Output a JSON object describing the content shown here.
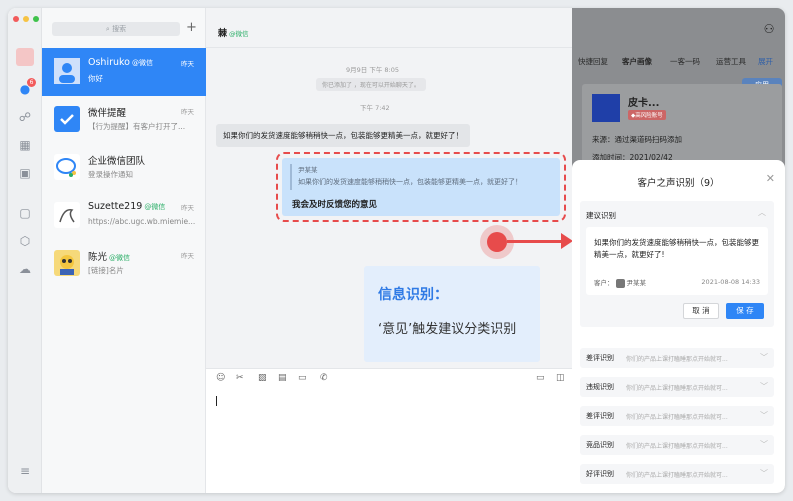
{
  "list": {
    "search_placeholder": "搜索",
    "conversations": [
      {
        "name": "Oshiruko",
        "tag": "@微信",
        "time": "昨天",
        "msg": "你好"
      },
      {
        "name": "微伴提醒",
        "tag": "",
        "time": "昨天",
        "msg": "【行为提醒】有客户打开了..."
      },
      {
        "name": "企业微信团队",
        "tag": "",
        "time": "",
        "msg": "登录操作通知"
      },
      {
        "name": "Suzette219",
        "tag": "@微信",
        "time": "昨天",
        "msg": "https://abc.ugc.wb.miemie..."
      },
      {
        "name": "陈光",
        "tag": "@微信",
        "time": "昨天",
        "msg": "[链接]名片"
      }
    ]
  },
  "chat": {
    "title": "棘",
    "title_tag": "@微信",
    "time1": "9月9日 下午 8:05",
    "sys_msg": "你已添加了      ，现在可以开始聊天了。",
    "time2": "下午 7:42",
    "left_msg": "如果你们的发货速度能够稍稍快一点，包装能够更精美一点，就更好了！",
    "quote_name": "尹某某",
    "quote_text": "如果你们的发货速度能够稍稍快一点，包装能够更精美一点，就更好了！",
    "reply_text": "我会及时反馈您的意见",
    "info_title": "信息识别：",
    "info_sub": "‘意见’触发建议分类识别"
  },
  "right": {
    "tabs": [
      "快捷回复",
      "客户画像",
      "一客一码",
      "运营工具",
      "展开"
    ],
    "apply_label": "应用",
    "customer_name": "皮卡...",
    "customer_badge": "◆高风险账号",
    "source_label": "来源：",
    "source_value": "通过渠道码扫码添加",
    "added_label": "添加时间：",
    "added_value": "2021/02/42"
  },
  "panel": {
    "title": "客户之声识别（9）",
    "open_section": {
      "label": "建议识别",
      "text": "如果你们的发货速度能够稍稍快一点，包装能够更精美一点，就更好了!",
      "customer_label": "客户：",
      "customer_name": "尹某某",
      "time": "2021-08-08 14:33",
      "cancel": "取 消",
      "save": "保 存"
    },
    "rows": [
      {
        "label": "差评识别",
        "preview": "你们的产品上课打瞌睡那点开始就可..."
      },
      {
        "label": "违规识别",
        "preview": "你们的产品上课打瞌睡那点开始就可..."
      },
      {
        "label": "差评识别",
        "preview": "你们的产品上课打瞌睡那点开始就可..."
      },
      {
        "label": "竞品识别",
        "preview": "你们的产品上课打瞌睡那点开始就可..."
      },
      {
        "label": "好评识别",
        "preview": "你们的产品上课打瞌睡那点开始就可..."
      }
    ]
  },
  "colors": {
    "accent": "#2f86f6",
    "alert": "#e74b4b",
    "wechat_tag": "#2aae67"
  }
}
